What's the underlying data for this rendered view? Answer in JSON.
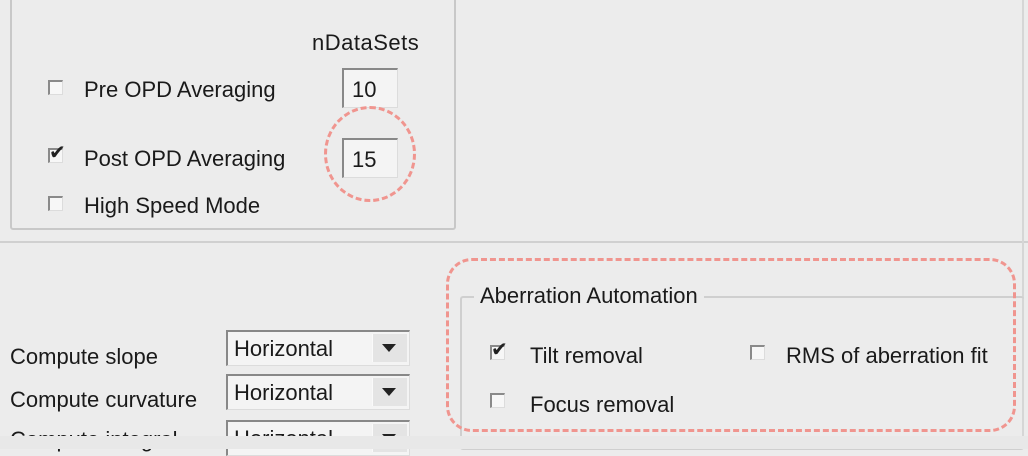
{
  "averaging": {
    "ndatasets_heading": "nDataSets",
    "pre_opd": {
      "label": "Pre OPD Averaging",
      "checked": false,
      "value": "10"
    },
    "post_opd": {
      "label": "Post OPD Averaging",
      "checked": true,
      "value": "15"
    },
    "high_speed": {
      "label": "High Speed Mode",
      "checked": false
    }
  },
  "compute": [
    {
      "label": "Compute slope",
      "value": "Horizontal"
    },
    {
      "label": "Compute curvature",
      "value": "Horizontal"
    },
    {
      "label": "Compute integral",
      "value": "Horizontal"
    }
  ],
  "aberration": {
    "title": "Aberration Automation",
    "tilt": {
      "label": "Tilt removal",
      "checked": true
    },
    "focus": {
      "label": "Focus removal",
      "checked": false
    },
    "rms": {
      "label": "RMS of aberration fit",
      "checked": false
    }
  },
  "icons": {
    "dropdown": "chevron-down-icon",
    "check": "checkmark-icon"
  },
  "colors": {
    "annotation": "#f0958f",
    "background": "#ececec"
  }
}
